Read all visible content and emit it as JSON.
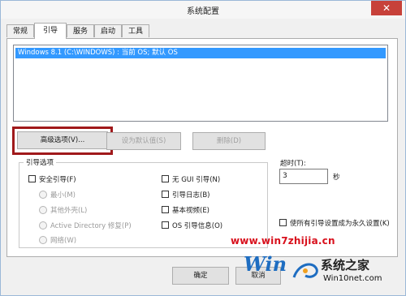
{
  "window": {
    "title": "系统配置",
    "close_glyph": "✕"
  },
  "tabs": [
    {
      "label": "常规",
      "active": false
    },
    {
      "label": "引导",
      "active": true
    },
    {
      "label": "服务",
      "active": false
    },
    {
      "label": "启动",
      "active": false
    },
    {
      "label": "工具",
      "active": false
    }
  ],
  "os_list": {
    "entries": [
      "Windows 8.1 (C:\\WINDOWS) : 当前 OS; 默认 OS"
    ],
    "selected_color": "#3399ff"
  },
  "buttons": {
    "advanced": "高级选项(V)...",
    "set_default": "设为默认值(S)",
    "delete": "删除(D)"
  },
  "boot_options": {
    "title": "引导选项",
    "safe_boot": "安全引导(F)",
    "minimal": "最小(M)",
    "alternate_shell": "其他外壳(L)",
    "active_directory": "Active Directory 修复(P)",
    "network": "网络(W)",
    "no_gui_boot": "无 GUI 引导(N)",
    "boot_log": "引导日志(B)",
    "base_video": "基本视频(E)",
    "os_boot_info": "OS 引导信息(O)"
  },
  "timeout": {
    "label": "超时(T):",
    "value": "3",
    "unit": "秒"
  },
  "make_permanent": "使所有引导设置成为永久设置(K)",
  "bottom_buttons": {
    "ok": "确定",
    "cancel": "取消"
  },
  "watermark": {
    "url": "www.win7zhijia.cn",
    "logo_text": "Win",
    "site_name": "系统之家",
    "site_url": "Win10net.com"
  },
  "colors": {
    "highlight_border": "#a0191b",
    "close_button": "#c7413a",
    "watermark_red": "#d8101c"
  }
}
